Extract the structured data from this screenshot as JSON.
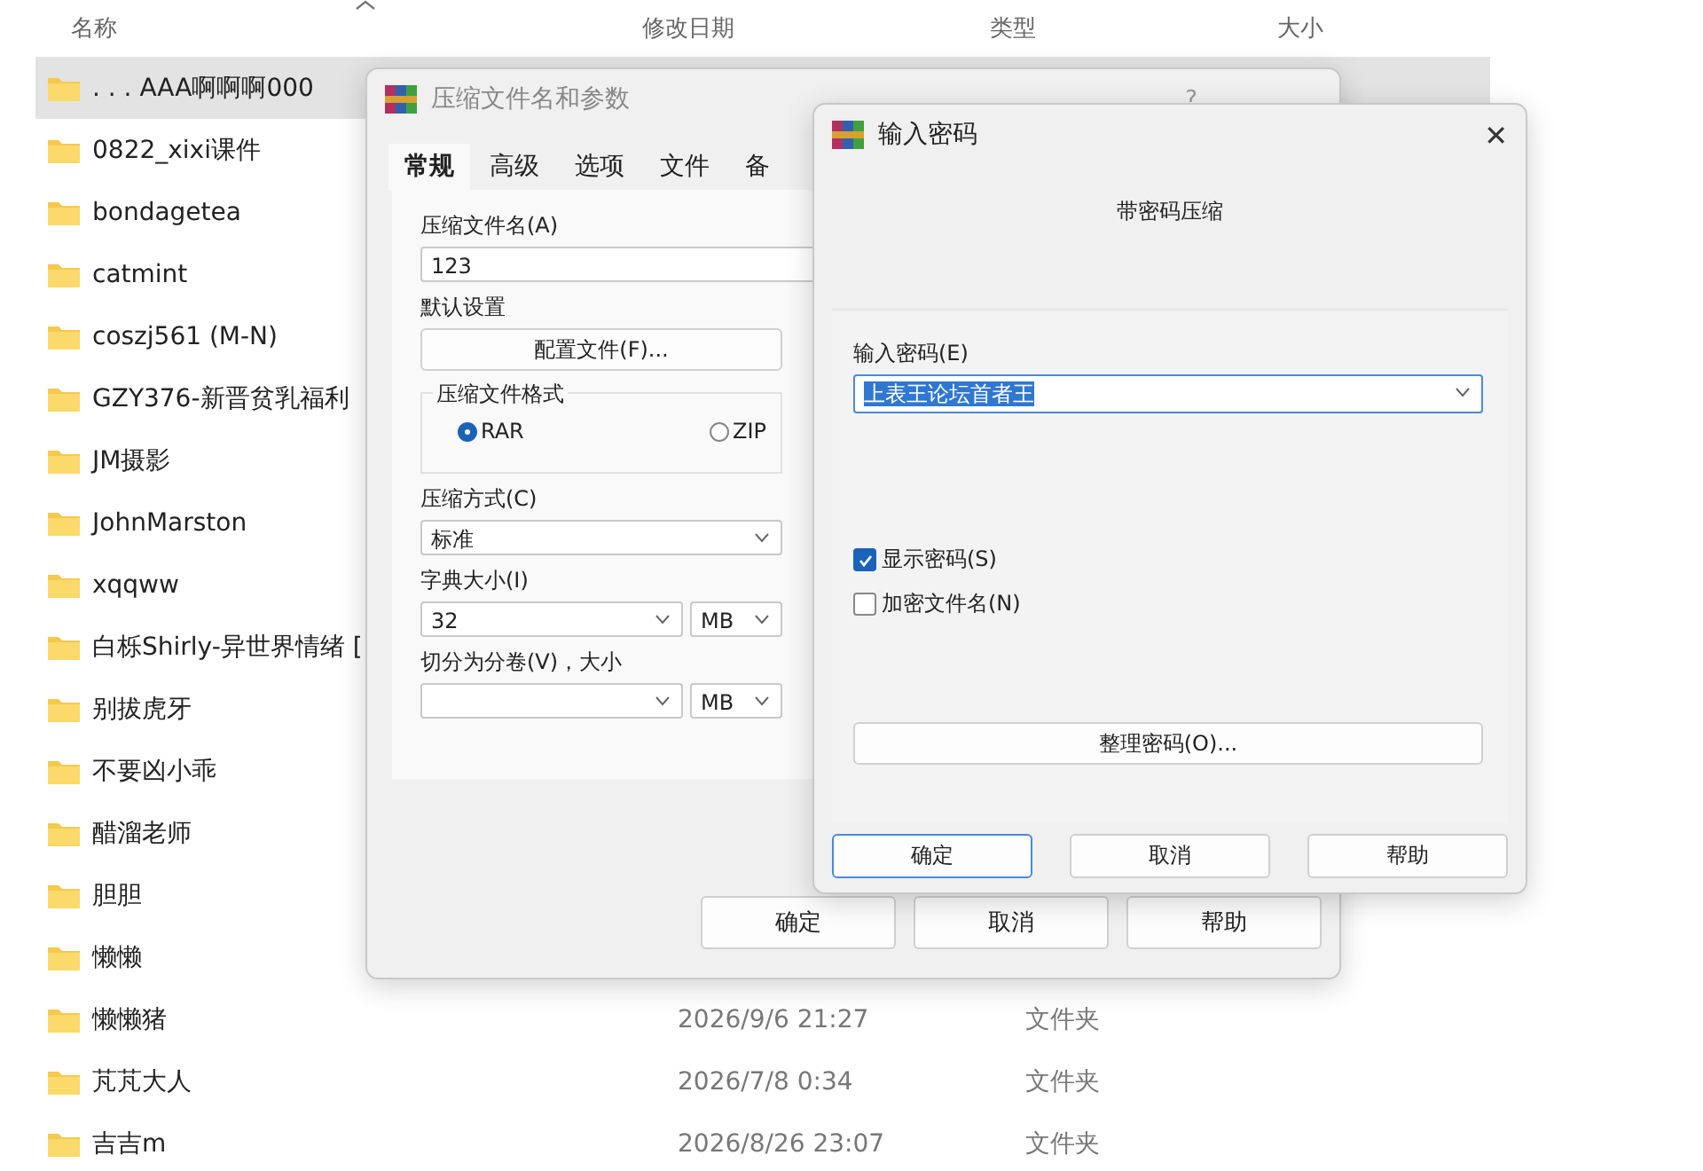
{
  "explorer": {
    "columns": [
      "名称",
      "修改日期",
      "类型",
      "大小"
    ],
    "rows": [
      {
        "name": ". . . AAA啊啊啊000",
        "selected": true
      },
      {
        "name": "0822_xixi课件",
        "selected": false
      },
      {
        "name": "bondagetea",
        "selected": false
      },
      {
        "name": "catmint",
        "selected": false
      },
      {
        "name": "coszj561 (M-N)",
        "selected": false
      },
      {
        "name": "GZY376-新晋贫乳福利",
        "selected": false
      },
      {
        "name": "JM摄影",
        "selected": false
      },
      {
        "name": "JohnMarston",
        "selected": false
      },
      {
        "name": "xqqww",
        "selected": false
      },
      {
        "name": "白栎Shirly-异世界情绪 [",
        "selected": false
      },
      {
        "name": "别拔虎牙",
        "selected": false
      },
      {
        "name": "不要凶小乖",
        "selected": false
      },
      {
        "name": "醋溜老师",
        "selected": false
      },
      {
        "name": "胆胆",
        "selected": false
      },
      {
        "name": "懒懒",
        "selected": false
      },
      {
        "name": "懒懒猪",
        "selected": false,
        "modified": "2026/9/6 21:27",
        "type": "文件夹"
      },
      {
        "name": "芃芃大人",
        "selected": false,
        "modified": "2026/7/8 0:34",
        "type": "文件夹"
      },
      {
        "name": "吉吉m",
        "selected": false,
        "modified": "2026/8/26 23:07",
        "type": "文件夹"
      }
    ]
  },
  "compress_dialog": {
    "title": "压缩文件名和参数",
    "help": "?",
    "tabs": [
      {
        "label": "常规",
        "selected": true
      },
      {
        "label": "高级",
        "selected": false
      },
      {
        "label": "选项",
        "selected": false
      },
      {
        "label": "文件",
        "selected": false
      },
      {
        "label": "备",
        "selected": false
      }
    ],
    "archive_name_label": "压缩文件名(A)",
    "archive_name": "123",
    "default_settings_label": "默认设置",
    "profiles_button": "配置文件(F)...",
    "format_group": "压缩文件格式",
    "formats": [
      {
        "label": "RAR",
        "selected": true
      },
      {
        "label": "ZIP",
        "selected": false
      }
    ],
    "method_label": "压缩方式(C)",
    "method": "标准",
    "dictionary_label": "字典大小(I)",
    "dictionary": "32",
    "dictionary_unit": "MB",
    "split_label": "切分为分卷(V)，大小",
    "split_unit": "MB",
    "buttons": [
      "确定",
      "取消",
      "帮助"
    ]
  },
  "password_dialog": {
    "title": "输入密码",
    "close": "✕",
    "heading": "带密码压缩",
    "password_label": "输入密码(E)",
    "password": "上表王论坛首者王",
    "options": [
      {
        "label": "显示密码(S)",
        "checked": true
      },
      {
        "label": "加密文件名(N)",
        "checked": false
      }
    ],
    "organize_button": "整理密码(O)...",
    "buttons": [
      {
        "label": "确定",
        "selected": true
      },
      {
        "label": "取消",
        "selected": false
      },
      {
        "label": "帮助",
        "selected": false
      }
    ]
  }
}
